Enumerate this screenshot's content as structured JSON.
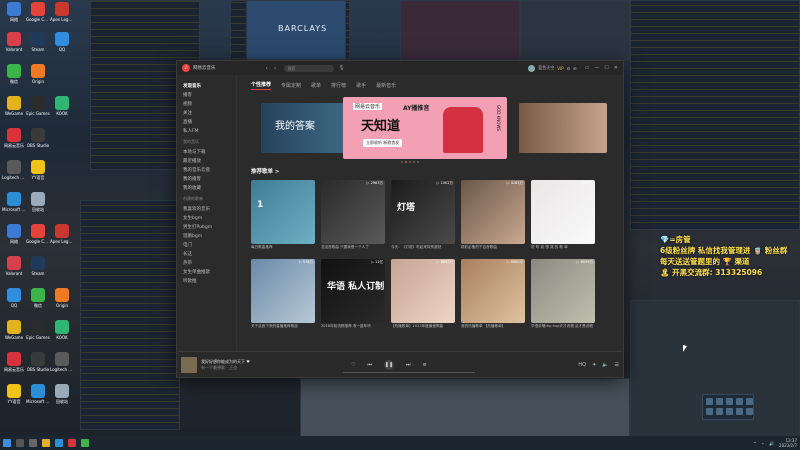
{
  "desktop": {
    "brand_sign": "BARCLAYS",
    "icons": [
      {
        "label": "网络",
        "color": "#3b7bd4"
      },
      {
        "label": "Google Chrome",
        "color": "#e3433a"
      },
      {
        "label": "Apex Legends",
        "color": "#c9382f"
      },
      {
        "label": "Valorant",
        "color": "#d6404a"
      },
      {
        "label": "Steam",
        "color": "#1f3a5a"
      },
      {
        "label": "QQ",
        "color": "#2f8ee0"
      },
      {
        "label": "微信",
        "color": "#3bb54a"
      },
      {
        "label": "Origin",
        "color": "#f07a24"
      },
      {
        "label": "WeGame",
        "color": "#e2b21f"
      },
      {
        "label": "Epic Games",
        "color": "#2b2b2b"
      },
      {
        "label": "KOOK",
        "color": "#2fb574"
      },
      {
        "label": "网易云音乐",
        "color": "#d8323c"
      },
      {
        "label": "OBS Studio",
        "color": "#3a3a3a"
      },
      {
        "label": "Logitech G HUB",
        "color": "#5a5a5a"
      },
      {
        "label": "YY语音",
        "color": "#f0c21a"
      },
      {
        "label": "Microsoft Edge",
        "color": "#2d8ed8"
      },
      {
        "label": "回收站",
        "color": "#9ab"
      }
    ]
  },
  "app": {
    "window_title": "网易云音乐",
    "search_placeholder": "搜索",
    "username": "蓝色天空",
    "vip": "VIP",
    "sidebar": {
      "top": [
        {
          "label": "发现音乐",
          "active": true
        },
        {
          "label": "播客"
        },
        {
          "label": "视频"
        },
        {
          "label": "关注"
        },
        {
          "label": "直播"
        },
        {
          "label": "私人FM"
        }
      ],
      "my_header": "我的音乐",
      "my_items": [
        {
          "label": "本地与下载"
        },
        {
          "label": "最近播放"
        },
        {
          "label": "我的音乐云盘"
        },
        {
          "label": "我的播客"
        },
        {
          "label": "我的收藏"
        }
      ],
      "playlist_header": "创建的歌单",
      "playlists": [
        {
          "label": "我喜欢的音乐"
        },
        {
          "label": "女生bgm"
        },
        {
          "label": "男生打Pubgm"
        },
        {
          "label": "思鹏bgm"
        },
        {
          "label": "电门"
        },
        {
          "label": "长这"
        },
        {
          "label": "热带"
        },
        {
          "label": "女生单曲推歌"
        },
        {
          "label": "听歌推"
        }
      ]
    },
    "tabs": [
      {
        "label": "个性推荐",
        "active": true
      },
      {
        "label": "专属定制"
      },
      {
        "label": "歌单"
      },
      {
        "label": "排行榜"
      },
      {
        "label": "歌手"
      },
      {
        "label": "最新音乐"
      }
    ],
    "banner": {
      "left_text": "我的答案",
      "main_tag": "网易云音乐",
      "main_top": "AY播推音",
      "main_title": "天知道",
      "main_button": "立即收听 新歌首发",
      "main_side": "GOD KNOWS"
    },
    "section_title": "推荐歌单 >",
    "playlists_rec": [
      {
        "caption": "每日歌曲推荐",
        "overlay": "1",
        "bg": "linear-gradient(135deg,#3e7c96,#6fb0c4)",
        "plays": ""
      },
      {
        "caption": "念这首歌曲 只要我是一个人了",
        "overlay": "",
        "bg": "linear-gradient(135deg,#2a2a2a,#5a5a5a)",
        "plays": "▷ 2983万"
      },
      {
        "caption": "今天：《灯塔》听起来特别超然",
        "overlay": "灯塔",
        "bg": "linear-gradient(135deg,#1c1c1c,#4a4a4a)",
        "plays": "▷ 1002万"
      },
      {
        "caption": "精彩必备的千百首歌曲",
        "overlay": "",
        "bg": "linear-gradient(135deg,#6a5848,#c9a890)",
        "plays": "▷ 4283万"
      },
      {
        "caption": "好 听 到 想 哭 的 歌 单",
        "overlay": "",
        "bg": "linear-gradient(135deg,#e9e6e6,#fafafa)",
        "plays": "▷ 1006万"
      },
      {
        "caption": "关于这首下来的直播推荐歌曲",
        "overlay": "",
        "bg": "linear-gradient(135deg,#6a8aa8,#b8c9d6)",
        "plays": "▷ 576万"
      },
      {
        "caption": "2018年轮流榜推荐 收一整年听",
        "overlay": "华语 私人订制",
        "bg": "linear-gradient(135deg,#111,#2a2a2a)",
        "plays": "▷ 11亿"
      },
      {
        "caption": "【热播歌单】2023年度最爱歌曲",
        "overlay": "",
        "bg": "linear-gradient(135deg,#c6a594,#efd4c4)",
        "plays": "▷ 8892万"
      },
      {
        "caption": "我的热播歌单 【热播歌单】",
        "overlay": "",
        "bg": "linear-gradient(135deg,#a88060,#e0c2a0)",
        "plays": "▷ 9000万"
      },
      {
        "caption": "华语说唱Hip-hop天才说唱 这才是说唱",
        "overlay": "",
        "bg": "linear-gradient(135deg,#8a8a80,#c0c0b0)",
        "plays": "▷ 6099万"
      }
    ],
    "player": {
      "song": "我好好想你能成为的天下 ♥",
      "artist": "有一个最想歌 - 王也",
      "time_left": "00:04",
      "time_right": "04:03"
    }
  },
  "overlay_text": [
    "💎=房管",
    "6级粉丝牌 私信找我管理进 🧋 粉丝群",
    "每天送送管题里的 🏆 渠道",
    "🏝 开黑交流群: 313325096"
  ],
  "taskbar": {
    "time": "13:37",
    "date": "2023/2/7"
  }
}
